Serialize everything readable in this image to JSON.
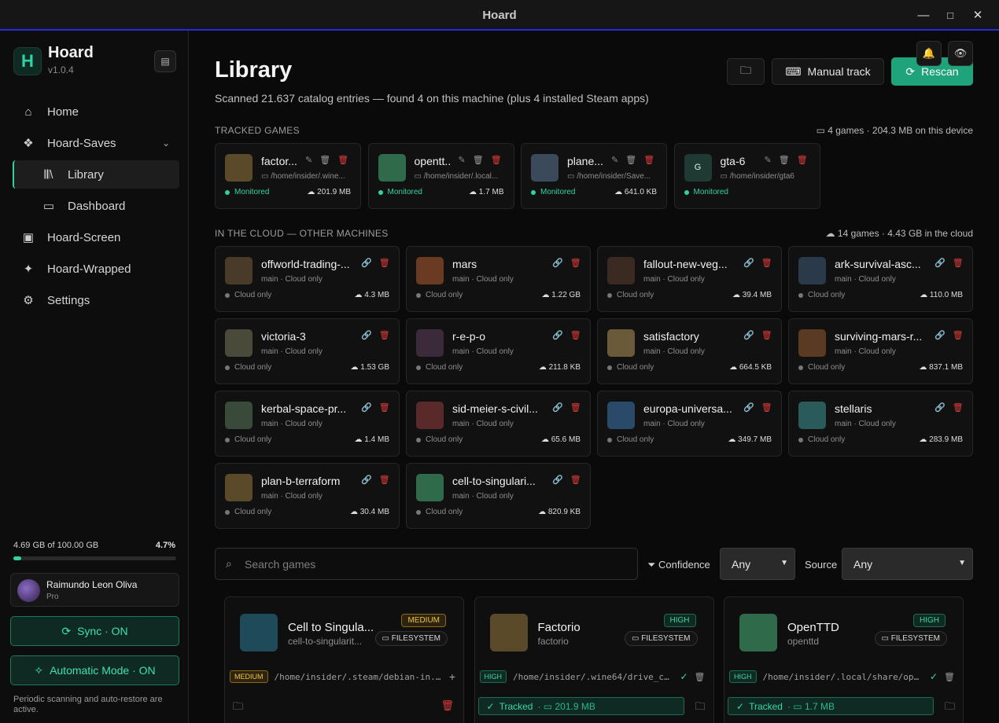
{
  "window": {
    "title": "Hoard",
    "minimize": "—",
    "maximize": "□",
    "close": "✕"
  },
  "sidebar": {
    "brand_letter": "H",
    "brand_name": "Hoard",
    "version": "v1.0.4",
    "nav": {
      "home": "Home",
      "hoard_saves": "Hoard-Saves",
      "library": "Library",
      "dashboard": "Dashboard",
      "hoard_screen": "Hoard-Screen",
      "hoard_wrapped": "Hoard-Wrapped",
      "settings": "Settings"
    },
    "storage_text": "4.69 GB of 100.00 GB",
    "storage_pct": "4.7%",
    "storage_fraction": 0.047,
    "user_name": "Raimundo Leon Oliva",
    "user_plan": "Pro",
    "sync_label": "Sync · ON",
    "auto_label": "Automatic Mode · ON",
    "footnote": "Periodic scanning and auto-restore are active."
  },
  "header": {
    "title": "Library",
    "subtitle": "Scanned 21.637 catalog entries — found 4 on this machine (plus 4 installed Steam apps)",
    "manual_track": "Manual track",
    "rescan": "Rescan"
  },
  "tracked": {
    "label": "TRACKED GAMES",
    "stat": "4 games · 204.3 MB on this device",
    "games": [
      {
        "name": "factor...",
        "path": "/home/insider/.wine...",
        "status": "Monitored",
        "size": "201.9 MB"
      },
      {
        "name": "opentt..",
        "path": "/home/insider/.local...",
        "status": "Monitored",
        "size": "1.7 MB"
      },
      {
        "name": "plane...",
        "path": "/home/insider/Save...",
        "status": "Monitored",
        "size": "641.0 KB"
      },
      {
        "name": "gta-6",
        "path": "/home/insider/gta6",
        "status": "Monitored",
        "size": ""
      }
    ]
  },
  "cloud": {
    "label": "IN THE CLOUD — OTHER MACHINES",
    "stat": "14 games · 4.43 GB in the cloud",
    "games": [
      {
        "name": "offworld-trading-...",
        "sub": "main · Cloud only",
        "status": "Cloud only",
        "size": "4.3 MB"
      },
      {
        "name": "mars",
        "sub": "main · Cloud only",
        "status": "Cloud only",
        "size": "1.22 GB"
      },
      {
        "name": "fallout-new-veg...",
        "sub": "main · Cloud only",
        "status": "Cloud only",
        "size": "39.4 MB"
      },
      {
        "name": "ark-survival-asc...",
        "sub": "main · Cloud only",
        "status": "Cloud only",
        "size": "110.0 MB"
      },
      {
        "name": "victoria-3",
        "sub": "main · Cloud only",
        "status": "Cloud only",
        "size": "1.53 GB"
      },
      {
        "name": "r-e-p-o",
        "sub": "main · Cloud only",
        "status": "Cloud only",
        "size": "211.8 KB"
      },
      {
        "name": "satisfactory",
        "sub": "main · Cloud only",
        "status": "Cloud only",
        "size": "664.5 KB"
      },
      {
        "name": "surviving-mars-r...",
        "sub": "main · Cloud only",
        "status": "Cloud only",
        "size": "837.1 MB"
      },
      {
        "name": "kerbal-space-pr...",
        "sub": "main · Cloud only",
        "status": "Cloud only",
        "size": "1.4 MB"
      },
      {
        "name": "sid-meier-s-civil...",
        "sub": "main · Cloud only",
        "status": "Cloud only",
        "size": "65.6 MB"
      },
      {
        "name": "europa-universa...",
        "sub": "main · Cloud only",
        "status": "Cloud only",
        "size": "349.7 MB"
      },
      {
        "name": "stellaris",
        "sub": "main · Cloud only",
        "status": "Cloud only",
        "size": "283.9 MB"
      },
      {
        "name": "plan-b-terraform",
        "sub": "main · Cloud only",
        "status": "Cloud only",
        "size": "30.4 MB"
      },
      {
        "name": "cell-to-singulari...",
        "sub": "main · Cloud only",
        "status": "Cloud only",
        "size": "820.9 KB"
      }
    ]
  },
  "filters": {
    "search_placeholder": "Search games",
    "confidence_label": "Confidence",
    "confidence_value": "Any",
    "source_label": "Source",
    "source_value": "Any"
  },
  "detected": [
    {
      "name": "Cell to Singula...",
      "id": "cell-to-singularit...",
      "confidence": "MEDIUM",
      "source": "FILESYSTEM",
      "path": "/home/insider/.steam/debian-in...",
      "tracked": false
    },
    {
      "name": "Factorio",
      "id": "factorio",
      "confidence": "HIGH",
      "source": "FILESYSTEM",
      "path": "/home/insider/.wine64/drive_c...",
      "tracked": true,
      "tracked_label": "Tracked",
      "size": "201.9 MB"
    },
    {
      "name": "OpenTTD",
      "id": "openttd",
      "confidence": "HIGH",
      "source": "FILESYSTEM",
      "path": "/home/insider/.local/share/op...",
      "tracked": true,
      "tracked_label": "Tracked",
      "size": "1.7 MB"
    }
  ],
  "colors": {
    "accent": "#2fd2a0",
    "danger": "#e23c3c",
    "medium": "#f2c13c",
    "rescan": "#1ea37b"
  }
}
